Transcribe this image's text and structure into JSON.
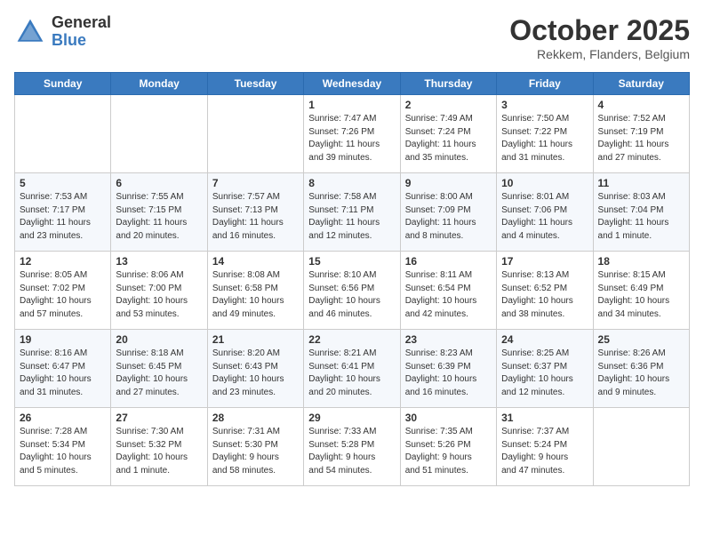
{
  "header": {
    "logo_general": "General",
    "logo_blue": "Blue",
    "month_title": "October 2025",
    "location": "Rekkem, Flanders, Belgium"
  },
  "weekdays": [
    "Sunday",
    "Monday",
    "Tuesday",
    "Wednesday",
    "Thursday",
    "Friday",
    "Saturday"
  ],
  "weeks": [
    [
      {
        "day": "",
        "info": ""
      },
      {
        "day": "",
        "info": ""
      },
      {
        "day": "",
        "info": ""
      },
      {
        "day": "1",
        "info": "Sunrise: 7:47 AM\nSunset: 7:26 PM\nDaylight: 11 hours\nand 39 minutes."
      },
      {
        "day": "2",
        "info": "Sunrise: 7:49 AM\nSunset: 7:24 PM\nDaylight: 11 hours\nand 35 minutes."
      },
      {
        "day": "3",
        "info": "Sunrise: 7:50 AM\nSunset: 7:22 PM\nDaylight: 11 hours\nand 31 minutes."
      },
      {
        "day": "4",
        "info": "Sunrise: 7:52 AM\nSunset: 7:19 PM\nDaylight: 11 hours\nand 27 minutes."
      }
    ],
    [
      {
        "day": "5",
        "info": "Sunrise: 7:53 AM\nSunset: 7:17 PM\nDaylight: 11 hours\nand 23 minutes."
      },
      {
        "day": "6",
        "info": "Sunrise: 7:55 AM\nSunset: 7:15 PM\nDaylight: 11 hours\nand 20 minutes."
      },
      {
        "day": "7",
        "info": "Sunrise: 7:57 AM\nSunset: 7:13 PM\nDaylight: 11 hours\nand 16 minutes."
      },
      {
        "day": "8",
        "info": "Sunrise: 7:58 AM\nSunset: 7:11 PM\nDaylight: 11 hours\nand 12 minutes."
      },
      {
        "day": "9",
        "info": "Sunrise: 8:00 AM\nSunset: 7:09 PM\nDaylight: 11 hours\nand 8 minutes."
      },
      {
        "day": "10",
        "info": "Sunrise: 8:01 AM\nSunset: 7:06 PM\nDaylight: 11 hours\nand 4 minutes."
      },
      {
        "day": "11",
        "info": "Sunrise: 8:03 AM\nSunset: 7:04 PM\nDaylight: 11 hours\nand 1 minute."
      }
    ],
    [
      {
        "day": "12",
        "info": "Sunrise: 8:05 AM\nSunset: 7:02 PM\nDaylight: 10 hours\nand 57 minutes."
      },
      {
        "day": "13",
        "info": "Sunrise: 8:06 AM\nSunset: 7:00 PM\nDaylight: 10 hours\nand 53 minutes."
      },
      {
        "day": "14",
        "info": "Sunrise: 8:08 AM\nSunset: 6:58 PM\nDaylight: 10 hours\nand 49 minutes."
      },
      {
        "day": "15",
        "info": "Sunrise: 8:10 AM\nSunset: 6:56 PM\nDaylight: 10 hours\nand 46 minutes."
      },
      {
        "day": "16",
        "info": "Sunrise: 8:11 AM\nSunset: 6:54 PM\nDaylight: 10 hours\nand 42 minutes."
      },
      {
        "day": "17",
        "info": "Sunrise: 8:13 AM\nSunset: 6:52 PM\nDaylight: 10 hours\nand 38 minutes."
      },
      {
        "day": "18",
        "info": "Sunrise: 8:15 AM\nSunset: 6:49 PM\nDaylight: 10 hours\nand 34 minutes."
      }
    ],
    [
      {
        "day": "19",
        "info": "Sunrise: 8:16 AM\nSunset: 6:47 PM\nDaylight: 10 hours\nand 31 minutes."
      },
      {
        "day": "20",
        "info": "Sunrise: 8:18 AM\nSunset: 6:45 PM\nDaylight: 10 hours\nand 27 minutes."
      },
      {
        "day": "21",
        "info": "Sunrise: 8:20 AM\nSunset: 6:43 PM\nDaylight: 10 hours\nand 23 minutes."
      },
      {
        "day": "22",
        "info": "Sunrise: 8:21 AM\nSunset: 6:41 PM\nDaylight: 10 hours\nand 20 minutes."
      },
      {
        "day": "23",
        "info": "Sunrise: 8:23 AM\nSunset: 6:39 PM\nDaylight: 10 hours\nand 16 minutes."
      },
      {
        "day": "24",
        "info": "Sunrise: 8:25 AM\nSunset: 6:37 PM\nDaylight: 10 hours\nand 12 minutes."
      },
      {
        "day": "25",
        "info": "Sunrise: 8:26 AM\nSunset: 6:36 PM\nDaylight: 10 hours\nand 9 minutes."
      }
    ],
    [
      {
        "day": "26",
        "info": "Sunrise: 7:28 AM\nSunset: 5:34 PM\nDaylight: 10 hours\nand 5 minutes."
      },
      {
        "day": "27",
        "info": "Sunrise: 7:30 AM\nSunset: 5:32 PM\nDaylight: 10 hours\nand 1 minute."
      },
      {
        "day": "28",
        "info": "Sunrise: 7:31 AM\nSunset: 5:30 PM\nDaylight: 9 hours\nand 58 minutes."
      },
      {
        "day": "29",
        "info": "Sunrise: 7:33 AM\nSunset: 5:28 PM\nDaylight: 9 hours\nand 54 minutes."
      },
      {
        "day": "30",
        "info": "Sunrise: 7:35 AM\nSunset: 5:26 PM\nDaylight: 9 hours\nand 51 minutes."
      },
      {
        "day": "31",
        "info": "Sunrise: 7:37 AM\nSunset: 5:24 PM\nDaylight: 9 hours\nand 47 minutes."
      },
      {
        "day": "",
        "info": ""
      }
    ]
  ]
}
